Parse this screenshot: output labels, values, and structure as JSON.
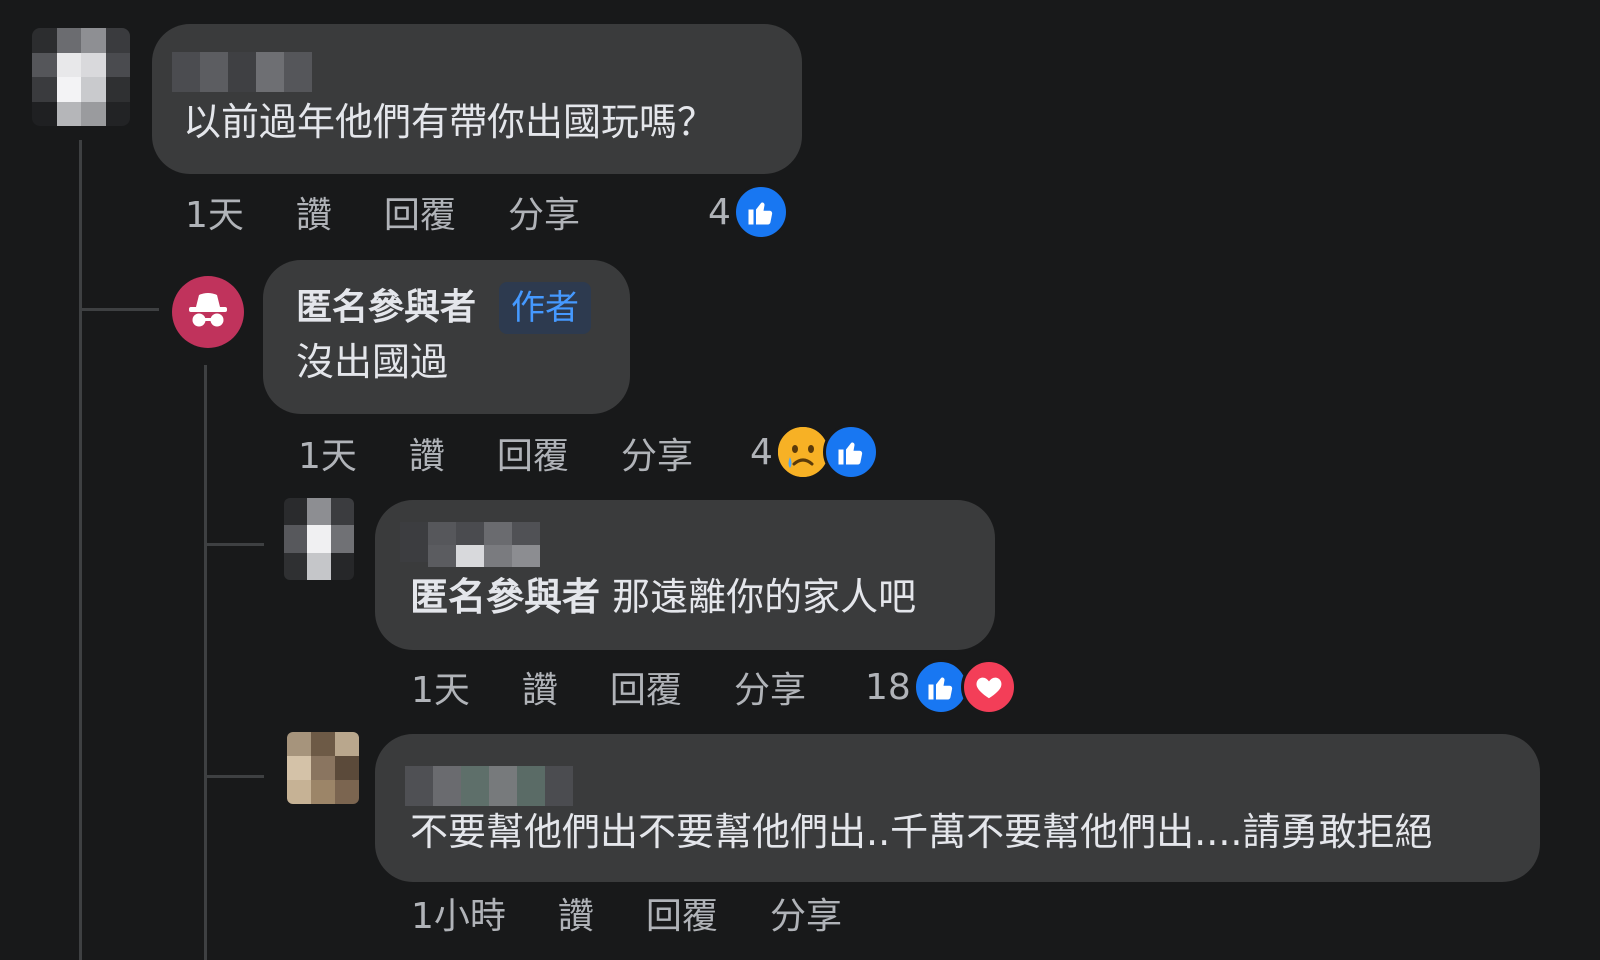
{
  "comments": [
    {
      "text": "以前過年他們有帶你出國玩嗎？",
      "time": "1天",
      "actions": [
        "讚",
        "回覆",
        "分享"
      ],
      "reaction_count": "4",
      "reactions": [
        "like-icon"
      ]
    },
    {
      "author": "匿名參與者",
      "badge": "作者",
      "text": "沒出國過",
      "time": "1天",
      "actions": [
        "讚",
        "回覆",
        "分享"
      ],
      "reaction_count": "4",
      "reactions": [
        "sad-icon",
        "like-icon"
      ]
    },
    {
      "mention": "匿名參與者",
      "text": "那遠離你的家人吧",
      "time": "1天",
      "actions": [
        "讚",
        "回覆",
        "分享"
      ],
      "reaction_count": "18",
      "reactions": [
        "like-icon",
        "love-icon"
      ]
    },
    {
      "text": "不要幫他們出不要幫他們出..千萬不要幫他們出....請勇敢拒絕",
      "time": "1小時",
      "actions": [
        "讚",
        "回覆",
        "分享"
      ]
    }
  ],
  "colors": {
    "background": "#18191a",
    "bubble": "#3a3b3c",
    "text": "#e4e6eb",
    "secondary_text": "#b0b3b8",
    "like": "#1877f2",
    "love": "#f33e58",
    "anon_avatar": "#c0335c",
    "badge_text": "#4599ff"
  }
}
